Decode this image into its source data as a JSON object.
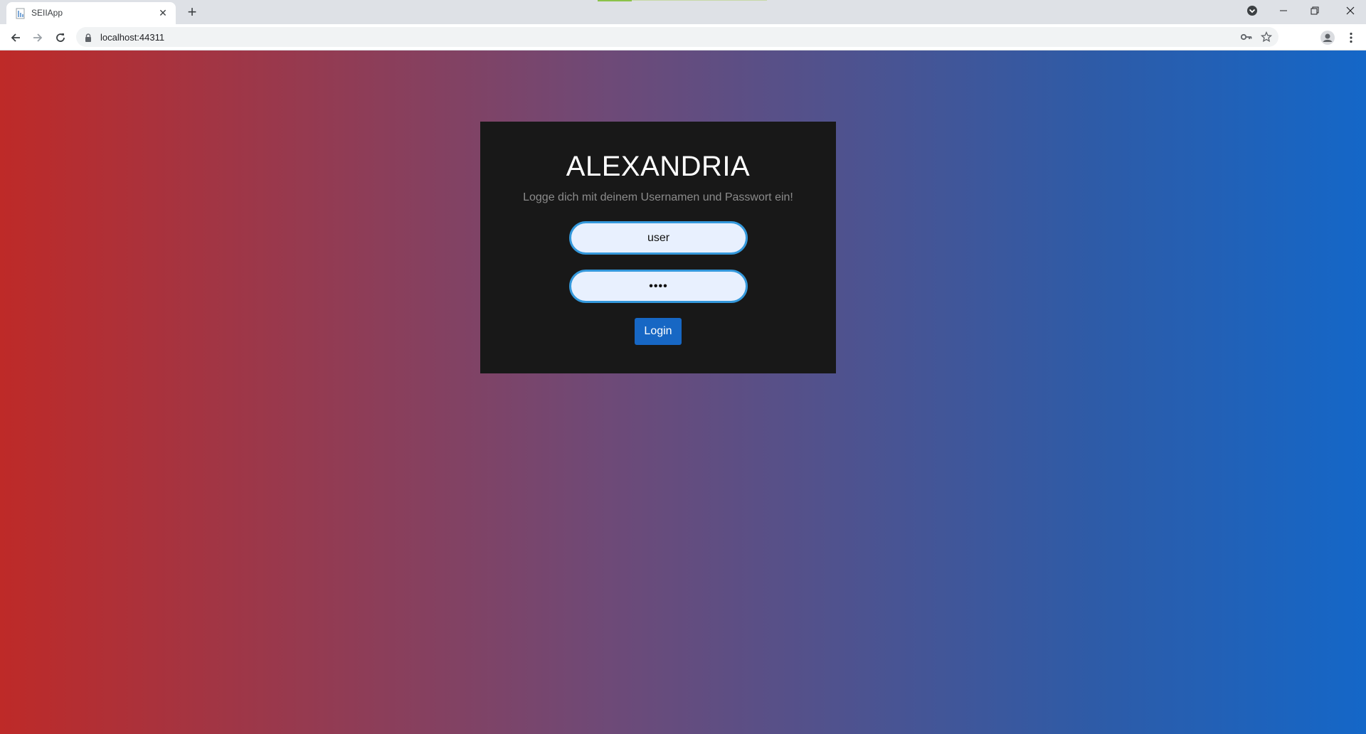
{
  "browser": {
    "tab": {
      "title": "SEIIApp",
      "favicon": "document-icon",
      "close_symbol": "✕"
    },
    "new_tab_symbol": "+",
    "url": "localhost:44311",
    "icons": [
      "back-icon",
      "forward-icon",
      "reload-icon",
      "lock-icon",
      "key-icon",
      "star-icon",
      "profile-icon",
      "kebab-menu-icon",
      "tab-search-icon",
      "minimize-icon",
      "restore-icon",
      "close-icon"
    ]
  },
  "page": {
    "background_colors": [
      "#be2a28",
      "#6d4a78",
      "#2e5ba7",
      "#1467c8"
    ],
    "login": {
      "title": "ALEXANDRIA",
      "subtitle": "Logge dich mit deinem Usernamen und Passwort ein!",
      "username_value": "user",
      "password_value": "••••",
      "button_label": "Login",
      "button_color": "#1767c4",
      "field_border_color": "#3498db"
    }
  }
}
